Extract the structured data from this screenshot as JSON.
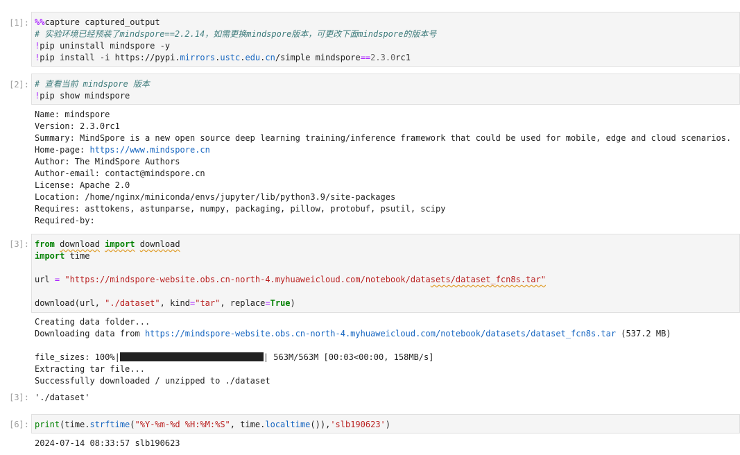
{
  "cells": [
    {
      "prompt": "[1]:",
      "code": {
        "line1_magic": "%%",
        "line1_rest": "capture captured_output",
        "line2_comment": "# 实验环境已经预装了mindspore==2.2.14，如需更换mindspore版本，可更改下面mindspore的版本号",
        "line3_bang": "!",
        "line3_rest": "pip uninstall mindspore -y",
        "line4_bang": "!",
        "line4_a": "pip install -i https://pypi.",
        "line4_b": "mirrors",
        "line4_c": ".",
        "line4_d": "ustc",
        "line4_e": ".",
        "line4_f": "edu",
        "line4_g": ".",
        "line4_h": "cn",
        "line4_i": "/simple mindspore",
        "line4_op": "==",
        "line4_ver": "2.3.0",
        "line4_end": "rc1"
      }
    },
    {
      "prompt": "[2]:",
      "code": {
        "line1_comment": "# 查看当前 mindspore 版本",
        "line2_bang": "!",
        "line2_rest": "pip show mindspore"
      },
      "output": {
        "name": "Name: mindspore",
        "version": "Version: 2.3.0rc1",
        "summary": "Summary: MindSpore is a new open source deep learning training/inference framework that could be used for mobile, edge and cloud scenarios.",
        "homepage_label": "Home-page: ",
        "homepage_link": "https://www.mindspore.cn",
        "author": "Author: The MindSpore Authors",
        "author_email": "Author-email: contact@mindspore.cn",
        "license": "License: Apache 2.0",
        "location": "Location: /home/nginx/miniconda/envs/jupyter/lib/python3.9/site-packages",
        "requires": "Requires: asttokens, astunparse, numpy, packaging, pillow, protobuf, psutil, scipy",
        "required_by": "Required-by:"
      }
    },
    {
      "prompt": "[3]:",
      "out_prompt": "[3]:",
      "code": {
        "from_kw": "from",
        "from_mod": "download",
        "import_kw": "import",
        "from_name": "download",
        "import2_kw": "import",
        "import2_mod": " time",
        "url_var": "url ",
        "url_eq": "=",
        "url_str_a": "\"https://mindspore-website.obs.cn-north-4.myhuaweicloud.com/notebook/data",
        "url_str_b": "sets/dataset_fcn8s.tar\"",
        "call_a": "download(url, ",
        "call_str1": "\"./dataset\"",
        "call_b": ", kind",
        "call_eq": "=",
        "call_str2": "\"tar\"",
        "call_c": ", replace",
        "call_eq2": "=",
        "call_true": "True",
        "call_d": ")"
      },
      "stream": {
        "creating": "Creating data folder...",
        "downloading_label": "Downloading data from ",
        "downloading_link": "https://mindspore-website.obs.cn-north-4.myhuaweicloud.com/notebook/datasets/dataset_fcn8s.tar",
        "downloading_size": " (537.2 MB)",
        "file_sizes_label": "file_sizes: 100%|",
        "progress": 1.0,
        "file_sizes_stats": "| 563M/563M [00:03<00:00, 158MB/s]",
        "extracting": "Extracting tar file...",
        "success": "Successfully downloaded / unzipped to ./dataset"
      },
      "result": "'./dataset'"
    },
    {
      "prompt": "[6]:",
      "code": {
        "print_fn": "print",
        "p1": "(time.",
        "p_attr1": "strftime",
        "p2": "(",
        "p_str1": "\"%Y-%m-%d %H:%M:%S\"",
        "p3": ", time.",
        "p_attr2": "localtime",
        "p4": "()),",
        "p_str2": "'slb190623'",
        "p5": ")"
      },
      "output": {
        "line": "2024-07-14 08:33:57 slb190623"
      }
    }
  ]
}
